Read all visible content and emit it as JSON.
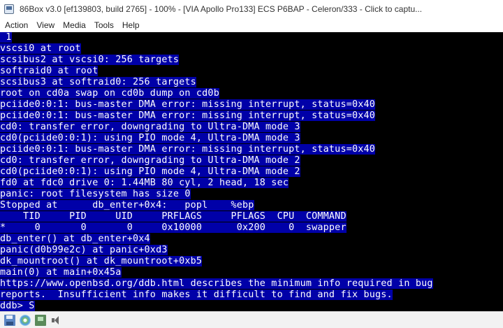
{
  "window": {
    "title": "86Box v3.0 [ef139803, build 2765] - 100% - [VIA Apollo Pro133] ECS P6BAP - Celeron/333 - Click to captu..."
  },
  "menu": {
    "items": [
      "Action",
      "View",
      "Media",
      "Tools",
      "Help"
    ]
  },
  "console": {
    "highlight_color": "#0000a8",
    "text_color": "#ffffff",
    "background_color": "#000000",
    "lines": [
      " 1",
      "vscsi0 at root",
      "scsibus2 at vscsi0: 256 targets",
      "softraid0 at root",
      "scsibus3 at softraid0: 256 targets",
      "root on cd0a swap on cd0b dump on cd0b",
      "pciide0:0:1: bus-master DMA error: missing interrupt, status=0x40",
      "pciide0:0:1: bus-master DMA error: missing interrupt, status=0x40",
      "cd0: transfer error, downgrading to Ultra-DMA mode 3",
      "cd0(pciide0:0:1): using PIO mode 4, Ultra-DMA mode 3",
      "pciide0:0:1: bus-master DMA error: missing interrupt, status=0x40",
      "cd0: transfer error, downgrading to Ultra-DMA mode 2",
      "cd0(pciide0:0:1): using PIO mode 4, Ultra-DMA mode 2",
      "fd0 at fdc0 drive 0: 1.44MB 80 cyl, 2 head, 18 sec",
      "panic: root filesystem has size 0",
      "Stopped at      db_enter+0x4:   popl    %ebp",
      "    TID     PID     UID     PRFLAGS     PFLAGS  CPU  COMMAND",
      "*     0       0       0     0x10000      0x200    0  swapper",
      "db_enter() at db_enter+0x4",
      "panic(d0b99e2c) at panic+0xd3",
      "dk_mountroot() at dk_mountroot+0xb5",
      "main(0) at main+0x45a",
      "https://www.openbsd.org/ddb.html describes the minimum info required in bug",
      "reports.  Insufficient info makes it difficult to find and fix bugs.",
      "ddb> S"
    ]
  },
  "statusbar": {
    "icons": [
      "floppy-icon",
      "cdrom-icon",
      "network-icon",
      "sound-icon"
    ]
  }
}
